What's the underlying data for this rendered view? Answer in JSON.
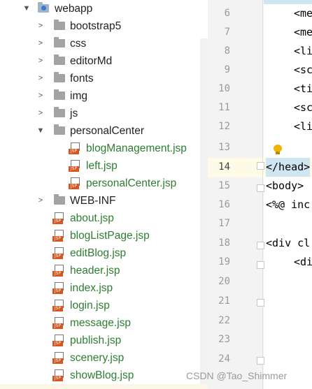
{
  "tree": {
    "root": "webapp",
    "folders": [
      "bootstrap5",
      "css",
      "editorMd",
      "fonts",
      "img",
      "js"
    ],
    "personal_center": {
      "name": "personalCenter",
      "files": [
        "blogManagement.jsp",
        "left.jsp",
        "personalCenter.jsp"
      ]
    },
    "web_inf": "WEB-INF",
    "files": [
      "about.jsp",
      "blogListPage.jsp",
      "editBlog.jsp",
      "header.jsp",
      "index.jsp",
      "login.jsp",
      "message.jsp",
      "publish.jsp",
      "scenery.jsp",
      "showBlog.jsp"
    ],
    "file_icon_tag": "JSP"
  },
  "editor": {
    "line_numbers": [
      "6",
      "7",
      "8",
      "9",
      "10",
      "11",
      "12",
      "13",
      "14",
      "15",
      "16",
      "17",
      "18",
      "19",
      "20",
      "21",
      "22",
      "23",
      "24"
    ],
    "lines": {
      "l6": "<me",
      "l7": "<me",
      "l8": "<li",
      "l9": "<sc",
      "l10": "<ti",
      "l11": "<sc",
      "l12": "<li",
      "l14": "</head>",
      "l15": "<body>",
      "l16": "<%@ inc",
      "l18": "<div cl",
      "l19": "<di"
    }
  },
  "watermark": "CSDN @Tao_Shimmer"
}
